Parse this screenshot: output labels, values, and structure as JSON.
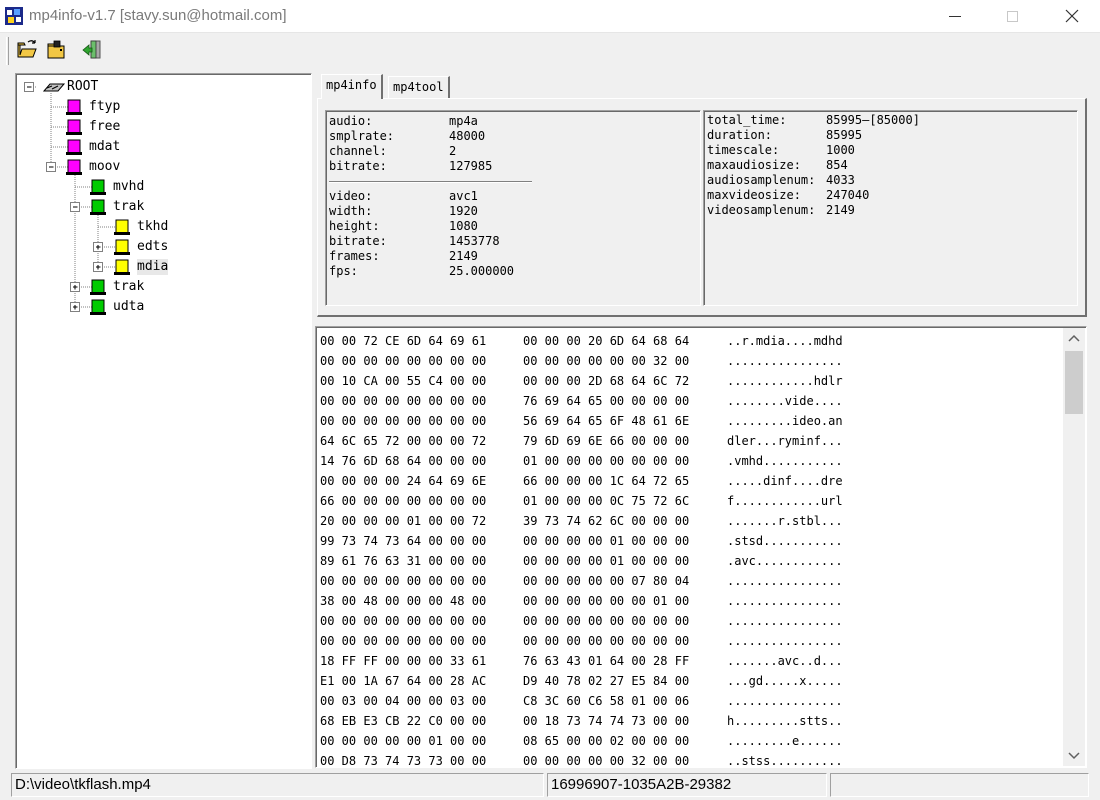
{
  "window": {
    "title": "mp4info-v1.7 [stavy.sun@hotmail.com]"
  },
  "toolbar": {
    "buttons": [
      {
        "icon": "folder-open-icon"
      },
      {
        "icon": "folder-open-icon"
      },
      {
        "icon": "exit-icon"
      }
    ]
  },
  "tree": {
    "nodes": [
      {
        "label": "ROOT",
        "icon": "root-drive-icon",
        "expander": "minus"
      },
      {
        "label": "ftyp",
        "icon": "magenta-box-icon"
      },
      {
        "label": "free",
        "icon": "magenta-box-icon"
      },
      {
        "label": "mdat",
        "icon": "magenta-box-icon"
      },
      {
        "label": "moov",
        "icon": "magenta-box-icon",
        "expander": "minus"
      },
      {
        "label": "mvhd",
        "icon": "green-box-icon"
      },
      {
        "label": "trak",
        "icon": "green-box-icon",
        "expander": "minus"
      },
      {
        "label": "tkhd",
        "icon": "yellow-box-icon"
      },
      {
        "label": "edts",
        "icon": "yellow-box-icon",
        "expander": "plus"
      },
      {
        "label": "mdia",
        "icon": "yellow-box-icon",
        "expander": "plus",
        "selected": true
      },
      {
        "label": "trak",
        "icon": "green-box-icon",
        "expander": "plus"
      },
      {
        "label": "udta",
        "icon": "green-box-icon",
        "expander": "plus"
      }
    ]
  },
  "tabs": [
    {
      "label": "mp4info",
      "active": true
    },
    {
      "label": "mp4tool",
      "active": false
    }
  ],
  "info_left": {
    "audio": [
      {
        "key": "audio:",
        "value": "mp4a"
      },
      {
        "key": "smplrate:",
        "value": "48000"
      },
      {
        "key": "channel:",
        "value": "2"
      },
      {
        "key": "bitrate:",
        "value": "127985"
      }
    ],
    "video": [
      {
        "key": "video:",
        "value": "avc1"
      },
      {
        "key": "width:",
        "value": "1920"
      },
      {
        "key": "height:",
        "value": "1080"
      },
      {
        "key": "bitrate:",
        "value": "1453778"
      },
      {
        "key": "frames:",
        "value": "2149"
      },
      {
        "key": "fps:",
        "value": "25.000000"
      }
    ]
  },
  "info_right": [
    {
      "key": "total_time:",
      "value": "85995—[85000]"
    },
    {
      "key": "duration:",
      "value": "85995"
    },
    {
      "key": "timescale:",
      "value": "1000"
    },
    {
      "key": "maxaudiosize:",
      "value": "854"
    },
    {
      "key": "audiosamplenum:",
      "value": "4033"
    },
    {
      "key": "maxvideosize:",
      "value": "247040"
    },
    {
      "key": "videosamplenum:",
      "value": "2149"
    }
  ],
  "hex_rows": [
    {
      "a": "00 00 72 CE 6D 64 69 61",
      "b": "00 00 00 20 6D 64 68 64",
      "c": "..r.mdia....mdhd"
    },
    {
      "a": "00 00 00 00 00 00 00 00",
      "b": "00 00 00 00 00 00 32 00",
      "c": "................"
    },
    {
      "a": "00 10 CA 00 55 C4 00 00",
      "b": "00 00 00 2D 68 64 6C 72",
      "c": "............hdlr"
    },
    {
      "a": "00 00 00 00 00 00 00 00",
      "b": "76 69 64 65 00 00 00 00",
      "c": "........vide...."
    },
    {
      "a": "00 00 00 00 00 00 00 00",
      "b": "56 69 64 65 6F 48 61 6E",
      "c": ".........ideo.an"
    },
    {
      "a": "64 6C 65 72 00 00 00 72",
      "b": "79 6D 69 6E 66 00 00 00",
      "c": "dler...ryminf..."
    },
    {
      "a": "14 76 6D 68 64 00 00 00",
      "b": "01 00 00 00 00 00 00 00",
      "c": ".vmhd..........."
    },
    {
      "a": "00 00 00 00 24 64 69 6E",
      "b": "66 00 00 00 1C 64 72 65",
      "c": ".....dinf....dre"
    },
    {
      "a": "66 00 00 00 00 00 00 00",
      "b": "01 00 00 00 0C 75 72 6C",
      "c": "f............url"
    },
    {
      "a": "20 00 00 00 01 00 00 72",
      "b": "39 73 74 62 6C 00 00 00",
      "c": ".......r.stbl..."
    },
    {
      "a": "99 73 74 73 64 00 00 00",
      "b": "00 00 00 00 01 00 00 00",
      "c": ".stsd..........."
    },
    {
      "a": "89 61 76 63 31 00 00 00",
      "b": "00 00 00 00 01 00 00 00",
      "c": ".avc............"
    },
    {
      "a": "00 00 00 00 00 00 00 00",
      "b": "00 00 00 00 00 07 80 04",
      "c": "................"
    },
    {
      "a": "38 00 48 00 00 00 48 00",
      "b": "00 00 00 00 00 00 01 00",
      "c": "................"
    },
    {
      "a": "00 00 00 00 00 00 00 00",
      "b": "00 00 00 00 00 00 00 00",
      "c": "................"
    },
    {
      "a": "00 00 00 00 00 00 00 00",
      "b": "00 00 00 00 00 00 00 00",
      "c": "................"
    },
    {
      "a": "18 FF FF 00 00 00 33 61",
      "b": "76 63 43 01 64 00 28 FF",
      "c": ".......avc..d..."
    },
    {
      "a": "E1 00 1A 67 64 00 28 AC",
      "b": "D9 40 78 02 27 E5 84 00",
      "c": "...gd.....x....."
    },
    {
      "a": "00 03 00 04 00 00 03 00",
      "b": "C8 3C 60 C6 58 01 00 06",
      "c": "................"
    },
    {
      "a": "68 EB E3 CB 22 C0 00 00",
      "b": "00 18 73 74 74 73 00 00",
      "c": "h.........stts.."
    },
    {
      "a": "00 00 00 00 00 01 00 00",
      "b": "08 65 00 00 02 00 00 00",
      "c": ".........e......"
    },
    {
      "a": "00 D8 73 74 73 73 00 00",
      "b": "00 00 00 00 00 32 00 00",
      "c": "..stss.........."
    }
  ],
  "status": {
    "path": "D:\\video\\tkflash.mp4",
    "id": "16996907-1035A2B-29382",
    "empty": ""
  },
  "colors": {
    "magenta": "#ff00ff",
    "green": "#00cc00",
    "yellow": "#ffff00",
    "panel": "#f0f0f0"
  }
}
